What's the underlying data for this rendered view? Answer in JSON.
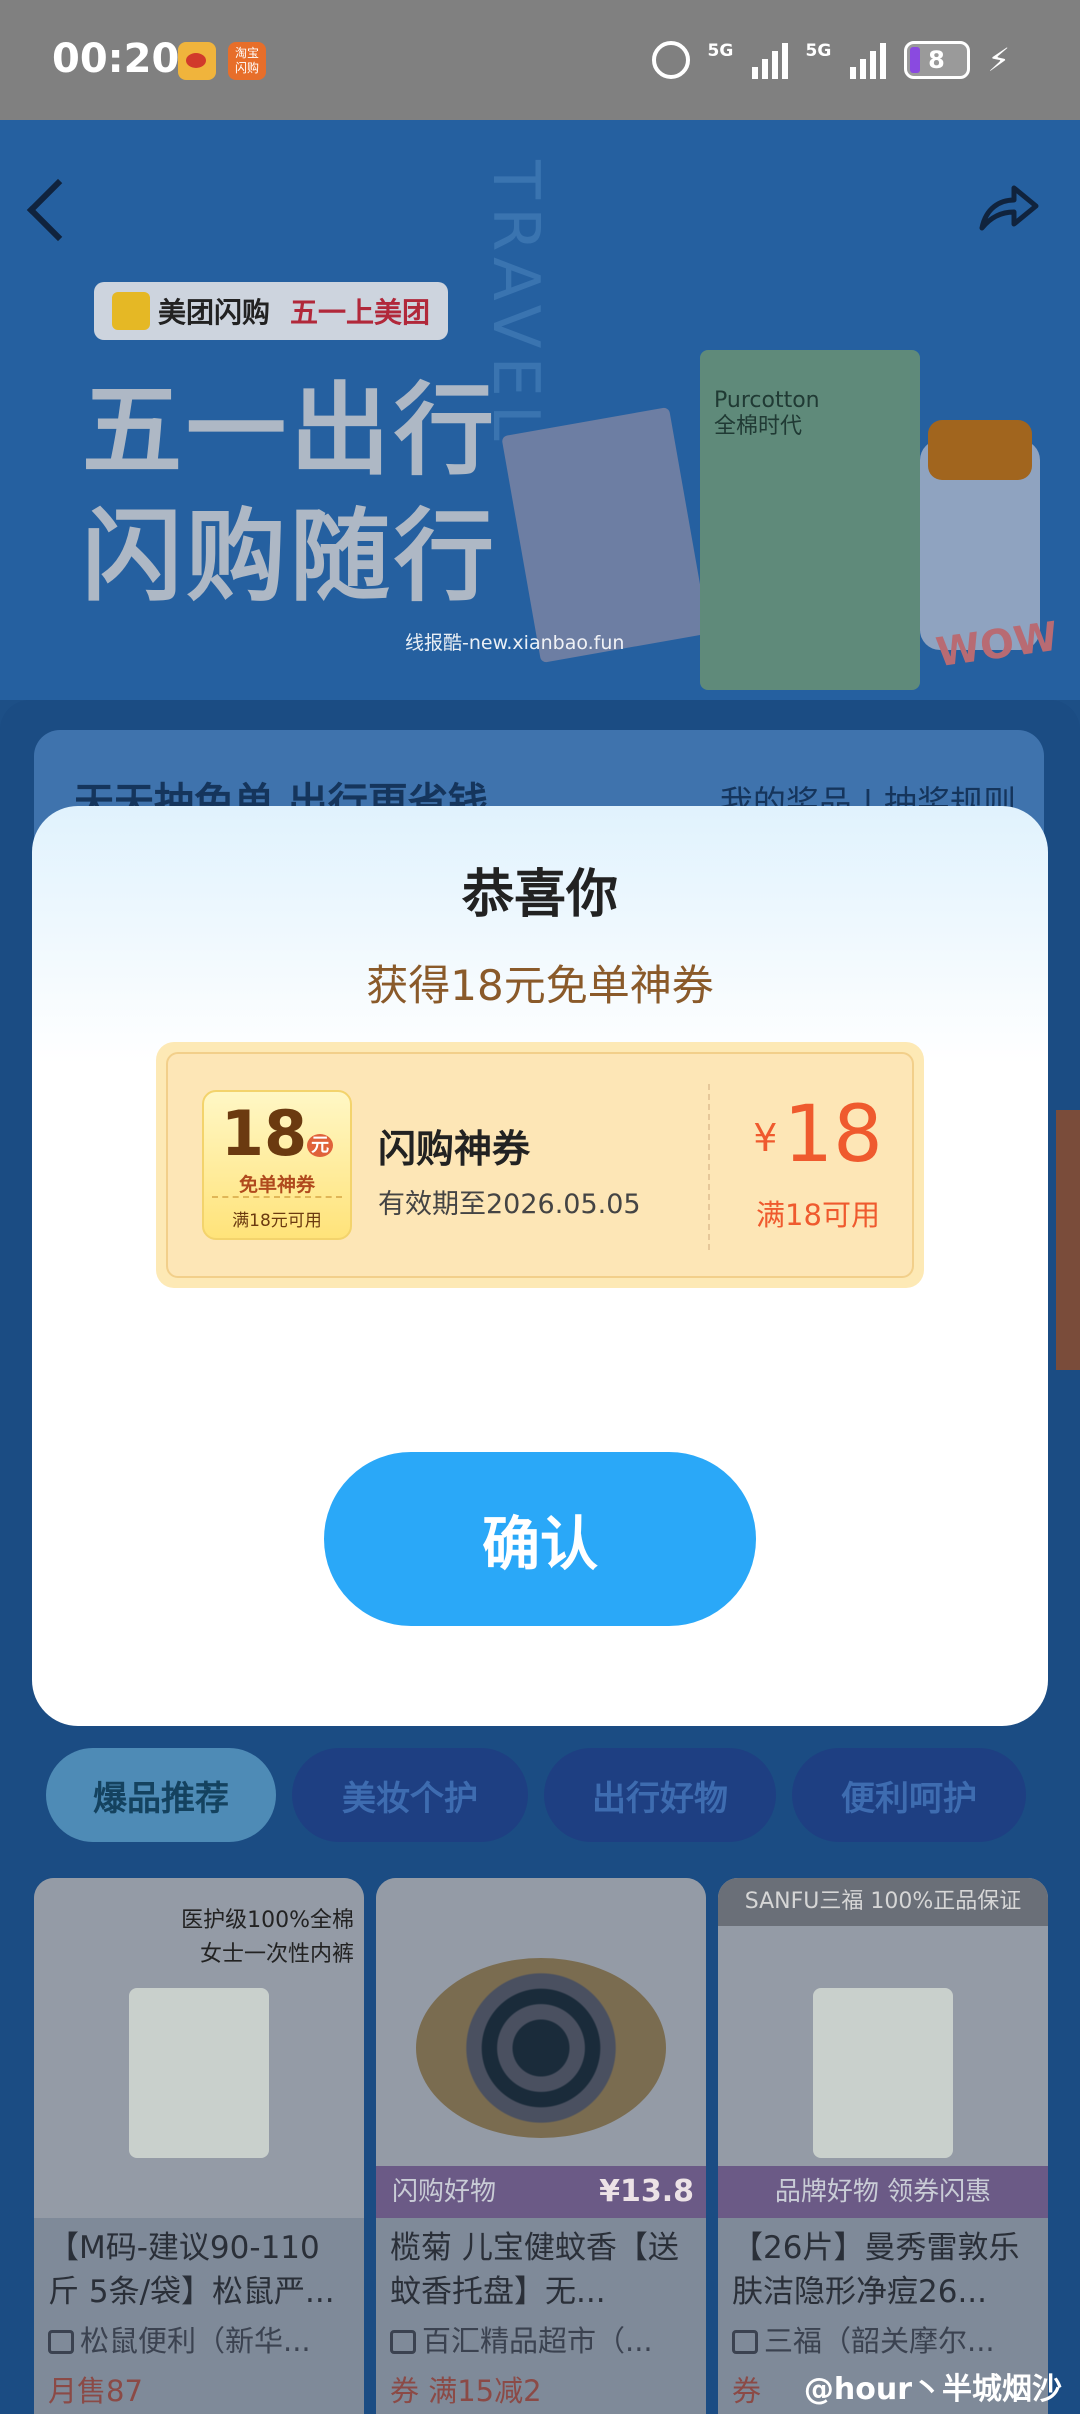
{
  "status_bar": {
    "time": "00:20",
    "taobao_label": "淘宝\n闪购",
    "signal_1": "5G",
    "signal_2": "5G",
    "battery": "8"
  },
  "banner": {
    "brand": "美团闪购",
    "brand_tagline": "五一上美团",
    "title_line1": "五一出行",
    "title_line2": "闪购随行",
    "travel_word": "TRAVEL",
    "product_b_label": "Purcotton\n全棉时代",
    "wow": "WOW",
    "watermark": "线报酷-new.xianbao.fun"
  },
  "lottery": {
    "title": "天天抽免单 出行更省钱",
    "links": "我的奖品 | 抽奖规则"
  },
  "modal": {
    "title": "恭喜你",
    "subtitle": "获得18元免单神券",
    "coupon": {
      "badge_amount": "18",
      "badge_yuan": "元",
      "badge_label": "免单神券",
      "badge_condition": "满18元可用",
      "name": "闪购神券",
      "validity": "有效期至2026.05.05",
      "currency": "¥",
      "value": "18",
      "condition": "满18可用"
    },
    "confirm_label": "确认"
  },
  "tabs": [
    {
      "label": "爆品推荐",
      "active": true
    },
    {
      "label": "美妆个护",
      "active": false
    },
    {
      "label": "出行好物",
      "active": false
    },
    {
      "label": "便利呵护",
      "active": false
    }
  ],
  "products": [
    {
      "image_text": "医护级100%全棉\n女士一次性内裤",
      "title": "【M码-建议90-110斤 5条/袋】松鼠严...",
      "shop": "松鼠便利（新华...",
      "footer": "月售87"
    },
    {
      "ribbon": "闪购好物",
      "price": "¥13.8",
      "title": "榄菊 儿宝健蚊香【送蚊香托盘】无...",
      "shop": "百汇精品超市（...",
      "footer": "券 满15减2"
    },
    {
      "brand_top": "SANFU三福 100%正品保证",
      "ribbon": "品牌好物 领券闪惠",
      "title": "【26片】曼秀雷敦乐肤洁隐形净痘26...",
      "shop": "三福（韶关摩尔...",
      "footer": "券"
    }
  ],
  "watermark_bottom": "@hour丶半城烟沙"
}
